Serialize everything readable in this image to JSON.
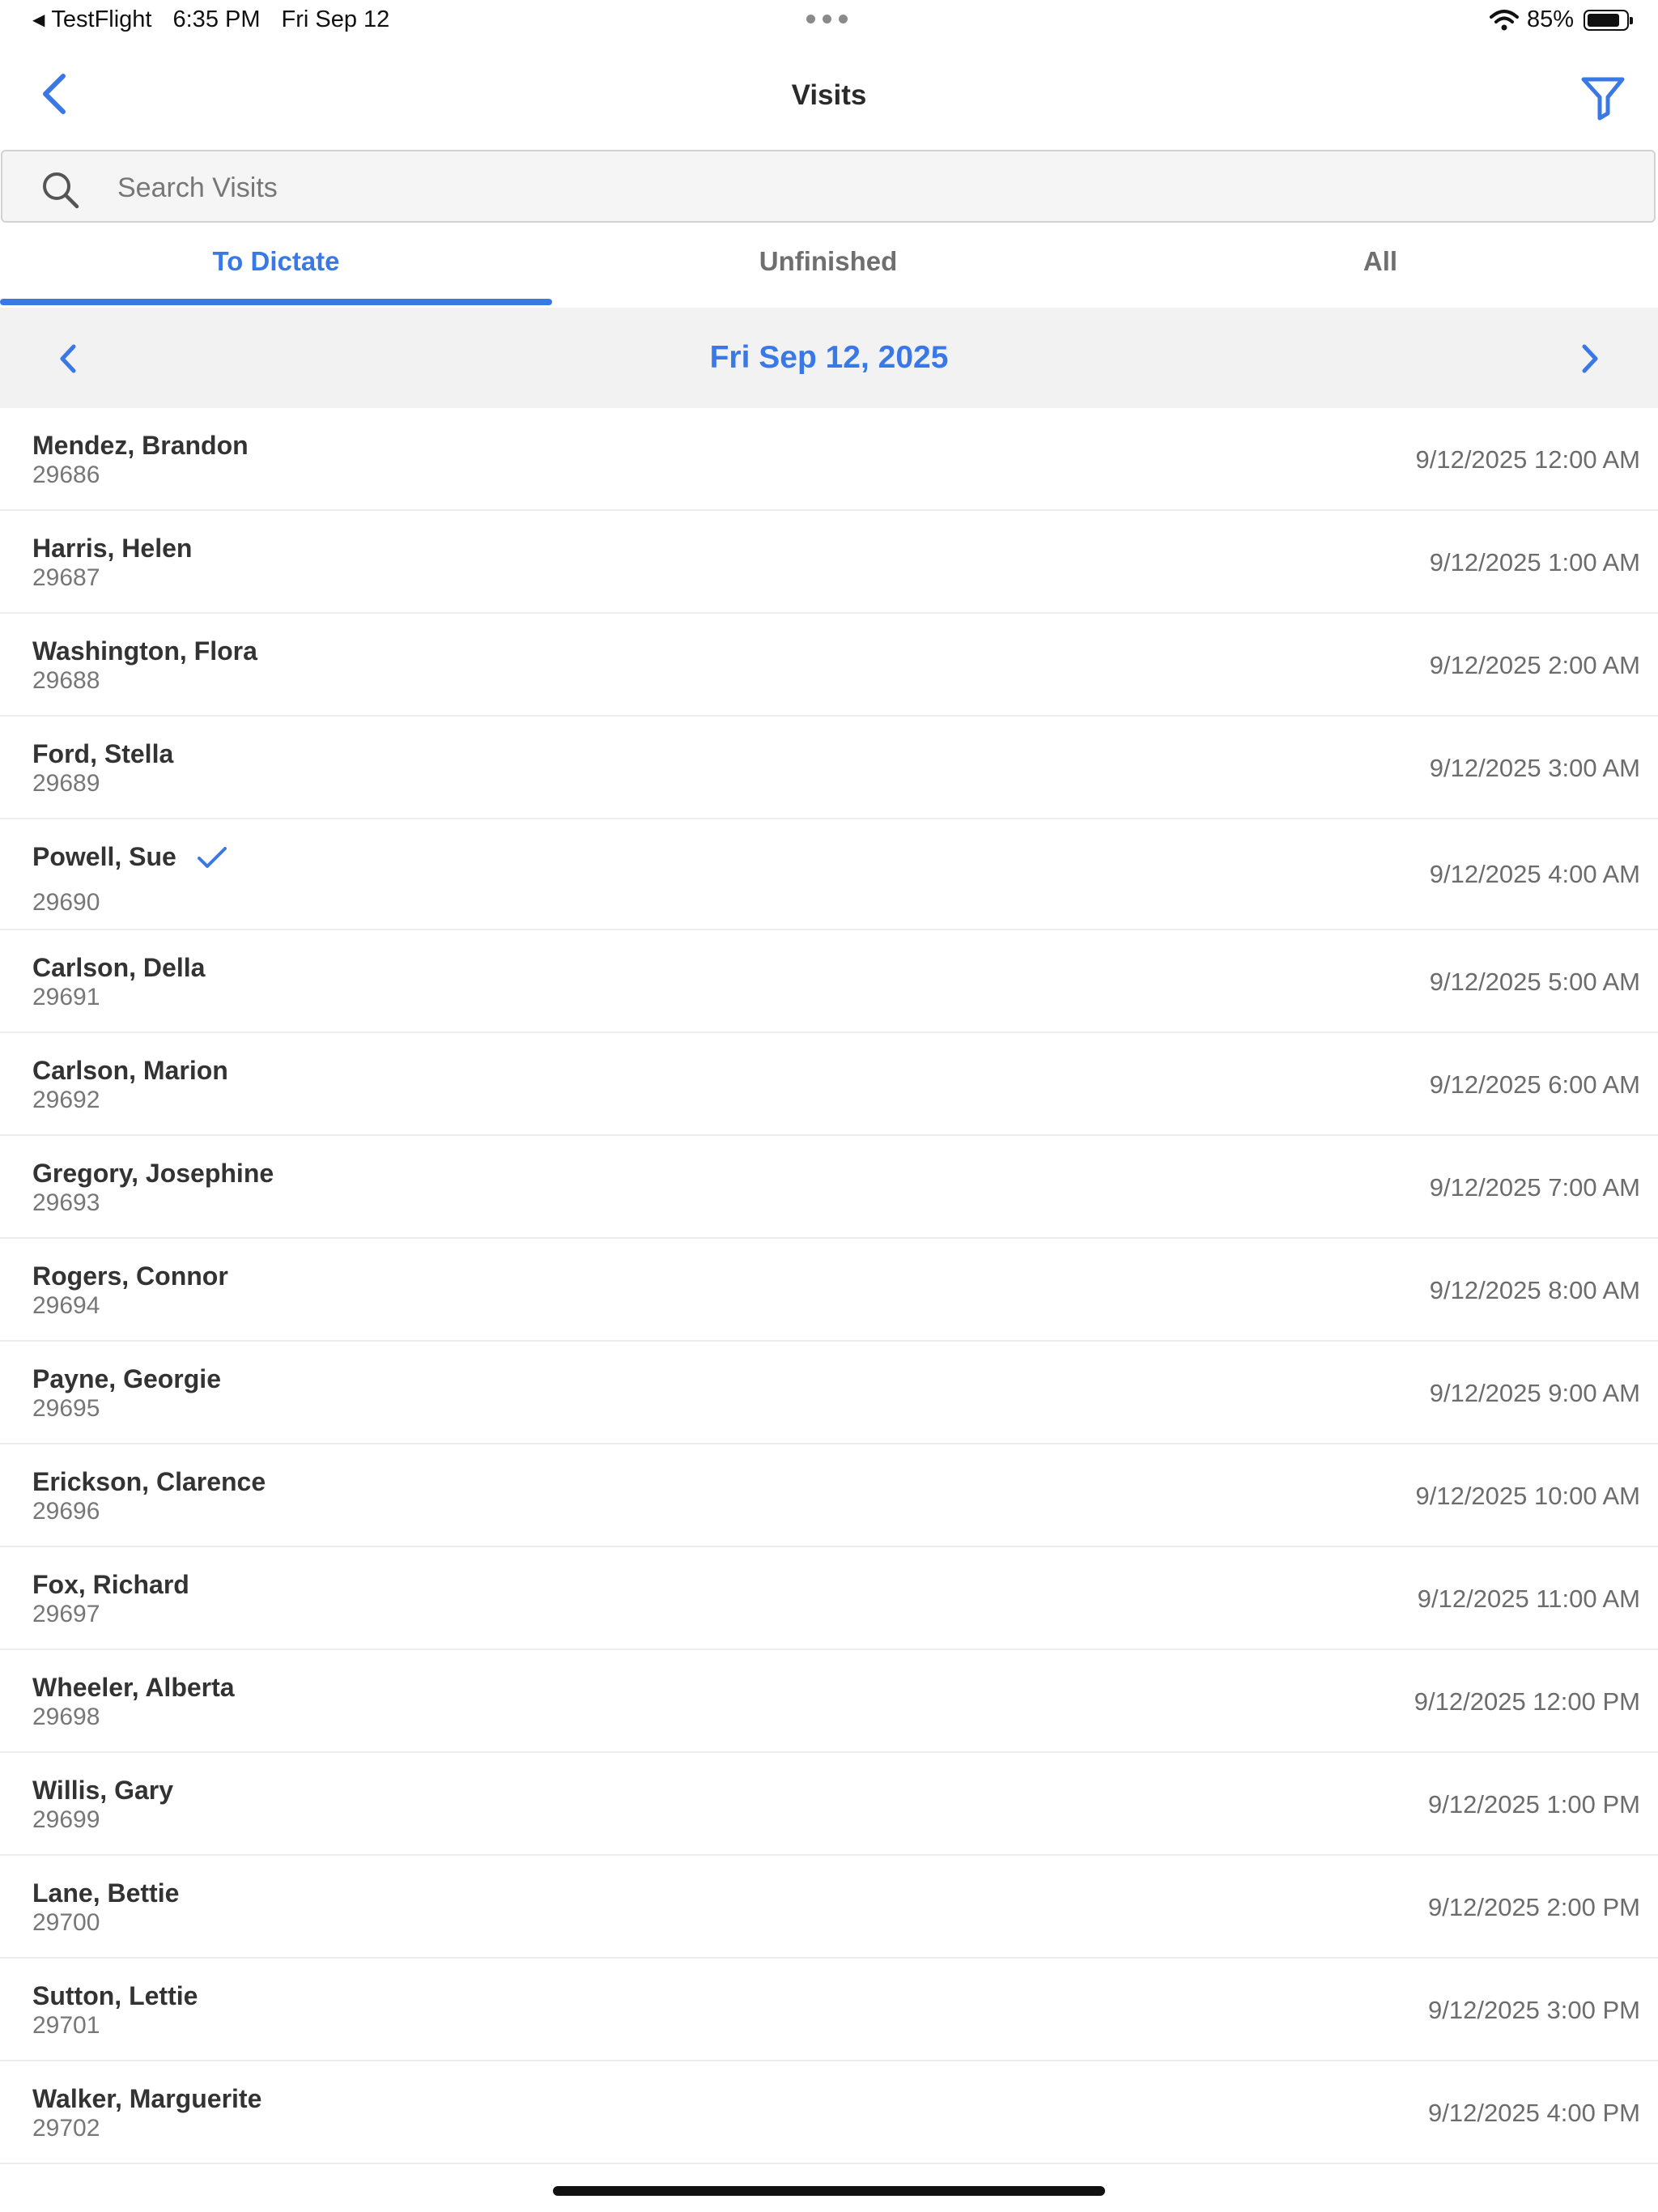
{
  "status_bar": {
    "back_app": "TestFlight",
    "time": "6:35 PM",
    "date": "Fri Sep 12",
    "battery": "85%",
    "battery_level": 0.85
  },
  "nav": {
    "title": "Visits"
  },
  "search": {
    "placeholder": "Search Visits",
    "value": ""
  },
  "tabs": [
    {
      "label": "To Dictate",
      "active": true
    },
    {
      "label": "Unfinished",
      "active": false
    },
    {
      "label": "All",
      "active": false
    }
  ],
  "date_bar": {
    "label": "Fri Sep 12, 2025"
  },
  "visits": [
    {
      "name": "Mendez, Brandon",
      "id": "29686",
      "time": "9/12/2025 12:00 AM",
      "checked": false
    },
    {
      "name": "Harris, Helen",
      "id": "29687",
      "time": "9/12/2025 1:00 AM",
      "checked": false
    },
    {
      "name": "Washington, Flora",
      "id": "29688",
      "time": "9/12/2025 2:00 AM",
      "checked": false
    },
    {
      "name": "Ford, Stella",
      "id": "29689",
      "time": "9/12/2025 3:00 AM",
      "checked": false
    },
    {
      "name": "Powell, Sue",
      "id": "29690",
      "time": "9/12/2025 4:00 AM",
      "checked": true
    },
    {
      "name": "Carlson, Della",
      "id": "29691",
      "time": "9/12/2025 5:00 AM",
      "checked": false
    },
    {
      "name": "Carlson, Marion",
      "id": "29692",
      "time": "9/12/2025 6:00 AM",
      "checked": false
    },
    {
      "name": "Gregory, Josephine",
      "id": "29693",
      "time": "9/12/2025 7:00 AM",
      "checked": false
    },
    {
      "name": "Rogers, Connor",
      "id": "29694",
      "time": "9/12/2025 8:00 AM",
      "checked": false
    },
    {
      "name": "Payne, Georgie",
      "id": "29695",
      "time": "9/12/2025 9:00 AM",
      "checked": false
    },
    {
      "name": "Erickson, Clarence",
      "id": "29696",
      "time": "9/12/2025 10:00 AM",
      "checked": false
    },
    {
      "name": "Fox, Richard",
      "id": "29697",
      "time": "9/12/2025 11:00 AM",
      "checked": false
    },
    {
      "name": "Wheeler, Alberta",
      "id": "29698",
      "time": "9/12/2025 12:00 PM",
      "checked": false
    },
    {
      "name": "Willis, Gary",
      "id": "29699",
      "time": "9/12/2025 1:00 PM",
      "checked": false
    },
    {
      "name": "Lane, Bettie",
      "id": "29700",
      "time": "9/12/2025 2:00 PM",
      "checked": false
    },
    {
      "name": "Sutton, Lettie",
      "id": "29701",
      "time": "9/12/2025 3:00 PM",
      "checked": false
    },
    {
      "name": "Walker, Marguerite",
      "id": "29702",
      "time": "9/12/2025 4:00 PM",
      "checked": false
    }
  ],
  "colors": {
    "accent": "#3a78e6",
    "date_bar_bg": "#f2f2f2",
    "divider": "#ececec"
  },
  "icons": {
    "back": "chevron-left-icon",
    "filter": "filter-icon",
    "search": "search-icon",
    "date_prev": "chevron-left-icon",
    "date_next": "chevron-right-icon",
    "row_check": "checkmark-icon"
  }
}
